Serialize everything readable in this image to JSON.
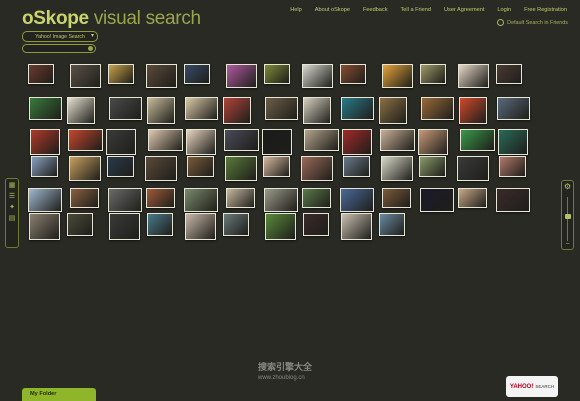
{
  "header": {
    "brand": "oSkope",
    "title_rest": "visual search"
  },
  "nav": [
    "Help",
    "About oSkope",
    "Feedback",
    "Tell a Friend",
    "User Agreement",
    "Login",
    "Free Registration"
  ],
  "default_search_label": "Default Search in Friends",
  "source_select": {
    "value": "Yahoo! Image Search"
  },
  "search": {
    "value": ""
  },
  "left_tools": [
    "grid-view-icon",
    "list-view-icon",
    "cluster-view-icon",
    "stack-view-icon"
  ],
  "zoom": {
    "level": 0.82
  },
  "folder": {
    "label": "My Folder"
  },
  "yahoo_badge": {
    "brand": "YAHOO!",
    "search": "SEARCH"
  },
  "watermark": {
    "text": "搜索引擎大全",
    "url": "www.zhoublog.cn"
  },
  "thumbnails_rows": [
    [
      "#6b3a2e",
      "#5a5048",
      "#c9a24a",
      "#5b4a3a",
      "#384a68",
      "#b05aa0",
      "#7f8a38",
      "#d8d8d0",
      "#8a4c32",
      "#e6a43a",
      "#9f9a68",
      "#e6d8c8",
      "#4c3a34"
    ],
    [
      "#3a7a3c",
      "#e6e0d0",
      "#4a4a4a",
      "#c7ba9a",
      "#d9c9a8",
      "#b0443a",
      "#6c5e48",
      "#d8d0c0",
      "#2a7a8a",
      "#8a7044",
      "#9a6a3a",
      "#d04a2a",
      "#5a6a7a"
    ],
    [
      "#b03a2a",
      "#c6462e",
      "#3a3a3a",
      "#e0c8b0",
      "#e8d4c0",
      "#4a4a5a",
      "#1a1a1a",
      "#b4a48c",
      "#a22a2a",
      "#c8b098",
      "#c89a7a",
      "#3a9a4a",
      "#2a6a5a"
    ],
    [
      "#8aa0c0",
      "#c8a060",
      "#2a3a4a",
      "#5a4a3a",
      "#7a5a3a",
      "#5a7a3a",
      "#d6b8a0",
      "#9a6a5a",
      "#6a7a8a",
      "#d8d8c8",
      "#8a9a6a",
      "#3a3a3a",
      "#b07a6a"
    ],
    [
      "#a0b8d0",
      "#8a6040",
      "#6a6a6a",
      "#a05a3a",
      "#7a8a6a",
      "#c8b8a0",
      "#9a9a8a",
      "#5a7a4a",
      "#4a6a9a",
      "#7a5a3a",
      "#1a1a2a",
      "#c8a888",
      "#3a2a2a"
    ],
    [
      "#8a8070",
      "#4a4a3a",
      "#3a3a3a",
      "#4a7a8a",
      "#c8b8a8",
      "#6a7a7a",
      "#5a8a3a",
      "#3a2a2a",
      "#c8c0b0",
      "#6a8aa0"
    ]
  ]
}
